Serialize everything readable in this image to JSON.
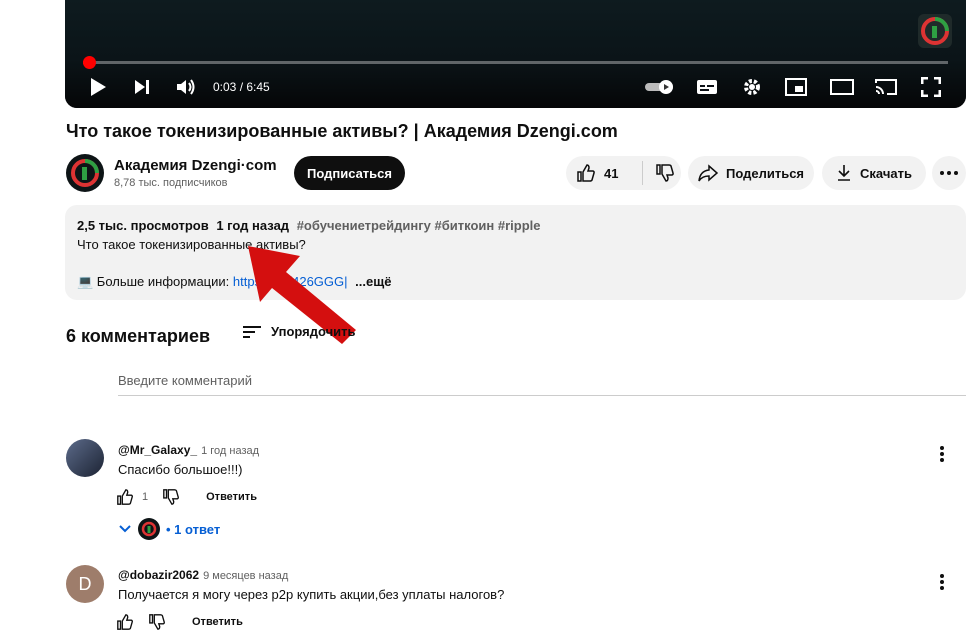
{
  "player": {
    "time": "0:03 / 6:45",
    "progress_fraction": 0.0074
  },
  "video": {
    "title": "Что такое токенизированные активы? | Академия Dzengi.com"
  },
  "channel": {
    "name": "Академия Dzengi·com",
    "subscribers": "8,78 тыс. подписчиков",
    "subscribe_label": "Подписаться"
  },
  "actions": {
    "likes": "41",
    "share_label": "Поделиться",
    "download_label": "Скачать"
  },
  "description": {
    "views": "2,5 тыс. просмотров",
    "published": "1 год назад",
    "hashtags": "#обучениетрейдингу #биткоин #ripple",
    "text": "Что такое токенизированные активы?",
    "more_info_label": "💻 Больше информации: ",
    "link_text": "https://i...j/426GGG|",
    "more_label": "...ещё"
  },
  "comments": {
    "count_label": "6 комментариев",
    "sort_label": "Упорядочить",
    "input_placeholder": "Введите комментарий",
    "items": [
      {
        "author": "@Mr_Galaxy_",
        "time": "1 год назад",
        "text": "Спасибо большое!!!)",
        "likes": "1",
        "reply_label": "Ответить",
        "replies_label": "• 1 ответ"
      },
      {
        "author": "@dobazir2062",
        "time": "9 месяцев назад",
        "text": "Получается я могу через p2p купить акции,без уплаты налогов?",
        "avatar_letter": "D",
        "reply_label": "Ответить"
      }
    ]
  },
  "colors": {
    "accent_red": "#ff0000",
    "link_blue": "#065fd4",
    "annotation_arrow": "#d40f0f"
  }
}
